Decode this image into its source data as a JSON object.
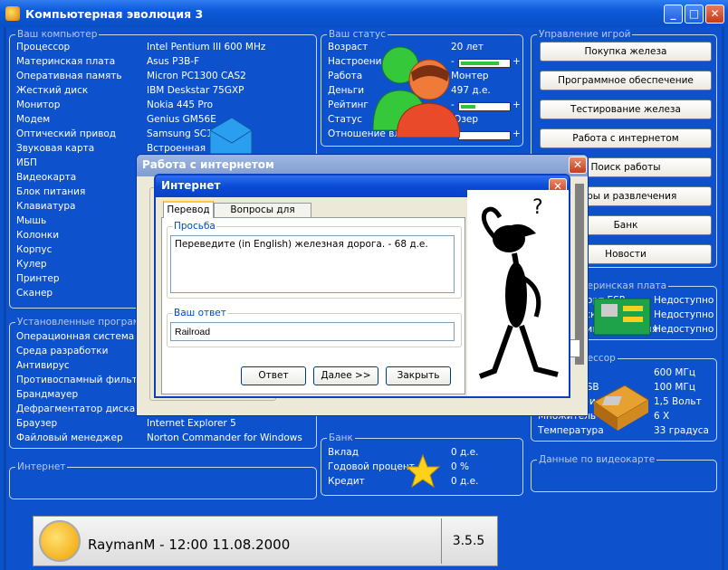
{
  "app": {
    "title": "Компьютерная эволюция 3",
    "min": "_",
    "max": "□",
    "close": "✕"
  },
  "computer": {
    "label": "Ваш компьютер",
    "rows": [
      [
        "Процессор",
        "Intel Pentium III 600 MHz"
      ],
      [
        "Материнская плата",
        "Asus P3B-F"
      ],
      [
        "Оперативная память",
        "Micron PC1300 CAS2"
      ],
      [
        "Жесткий диск",
        "IBM Deskstar 75GXP"
      ],
      [
        "Монитор",
        "Nokia 445 Pro"
      ],
      [
        "Модем",
        "Genius GM56E"
      ],
      [
        "Оптический привод",
        "Samsung SC148-F"
      ],
      [
        "Звуковая карта",
        "Встроенная"
      ],
      [
        "ИБП",
        ""
      ],
      [
        "Видеокарта",
        ""
      ],
      [
        "Блок питания",
        ""
      ],
      [
        "Клавиатура",
        ""
      ],
      [
        "Мышь",
        ""
      ],
      [
        "Колонки",
        ""
      ],
      [
        "Корпус",
        ""
      ],
      [
        "Кулер",
        ""
      ],
      [
        "Принтер",
        ""
      ],
      [
        "Сканер",
        ""
      ]
    ]
  },
  "software": {
    "label": "Установленные программы",
    "rows": [
      [
        "Операционная система",
        ""
      ],
      [
        "Среда разработки",
        ""
      ],
      [
        "Антивирус",
        ""
      ],
      [
        "Противоспамный фильтр",
        ""
      ],
      [
        "Брандмауер",
        ""
      ],
      [
        "Дефрагментатор диска",
        ""
      ],
      [
        "Браузер",
        "Internet Explorer 5"
      ],
      [
        "Файловый менеджер",
        "Norton Commander for Windows"
      ]
    ]
  },
  "internet_label": "Интернет",
  "status": {
    "label": "Ваш статус",
    "rows": [
      {
        "k": "Возраст",
        "v": "20 лет"
      },
      {
        "k": "Настроение",
        "bar": 0.8
      },
      {
        "k": "Работа",
        "v": "Монтер"
      },
      {
        "k": "Деньги",
        "v": "497 д.е."
      },
      {
        "k": "Рейтинг",
        "bar": 0.3
      },
      {
        "k": "Статус",
        "v": "Юзер"
      },
      {
        "k": "Отношение властей",
        "bar": 0.0
      }
    ],
    "minus": "-",
    "plus": "+"
  },
  "bank": {
    "label": "Банк",
    "rows": [
      [
        "Вклад",
        "0 д.е."
      ],
      [
        "Годовой процент",
        "0 %"
      ],
      [
        "Кредит",
        "0 д.е."
      ]
    ]
  },
  "menu": {
    "label": "Управление игрой",
    "buttons": [
      "Покупка железа",
      "Программное обеспечение",
      "Тестирование железа",
      "Работа с интернетом",
      "Поиск работы",
      "Игры и развлечения",
      "Банк",
      "Новости"
    ]
  },
  "mobo": {
    "label": "Ваша материнская плата",
    "rows": [
      [
        "Порт ESR",
        "Недоступно"
      ],
      [
        "Ускорение",
        "Недоступно"
      ],
      [
        "Синхронизация",
        "Недоступно"
      ]
    ]
  },
  "cpu": {
    "label": "Ваш процессор",
    "rows": [
      [
        "Частота",
        "600 МГц"
      ],
      [
        "Частота FSB",
        "100 МГц"
      ],
      [
        "Напряжение",
        "1,5 Вольт"
      ],
      [
        "Множитель",
        "6 X"
      ],
      [
        "Температура",
        "33 градуса"
      ]
    ]
  },
  "video_label": "Данные по видеокарте",
  "footer": {
    "user": "RaymanM - 12:00 11.08.2000",
    "version": "3.5.5"
  },
  "outer_dialog": {
    "title": "Работа с интернетом",
    "close": "✕"
  },
  "inner_dialog": {
    "title": "Интернет",
    "close": "✕",
    "tabs": [
      "Перевод",
      "Вопросы для профи"
    ],
    "request_label": "Просьба",
    "request_text": "Переведите (in English) железная дорога. - 68 д.е.",
    "answer_label": "Ваш ответ",
    "answer_value": "Railroad",
    "buttons": {
      "answer": "Ответ",
      "next": "Далее >>",
      "close": "Закрыть"
    }
  }
}
